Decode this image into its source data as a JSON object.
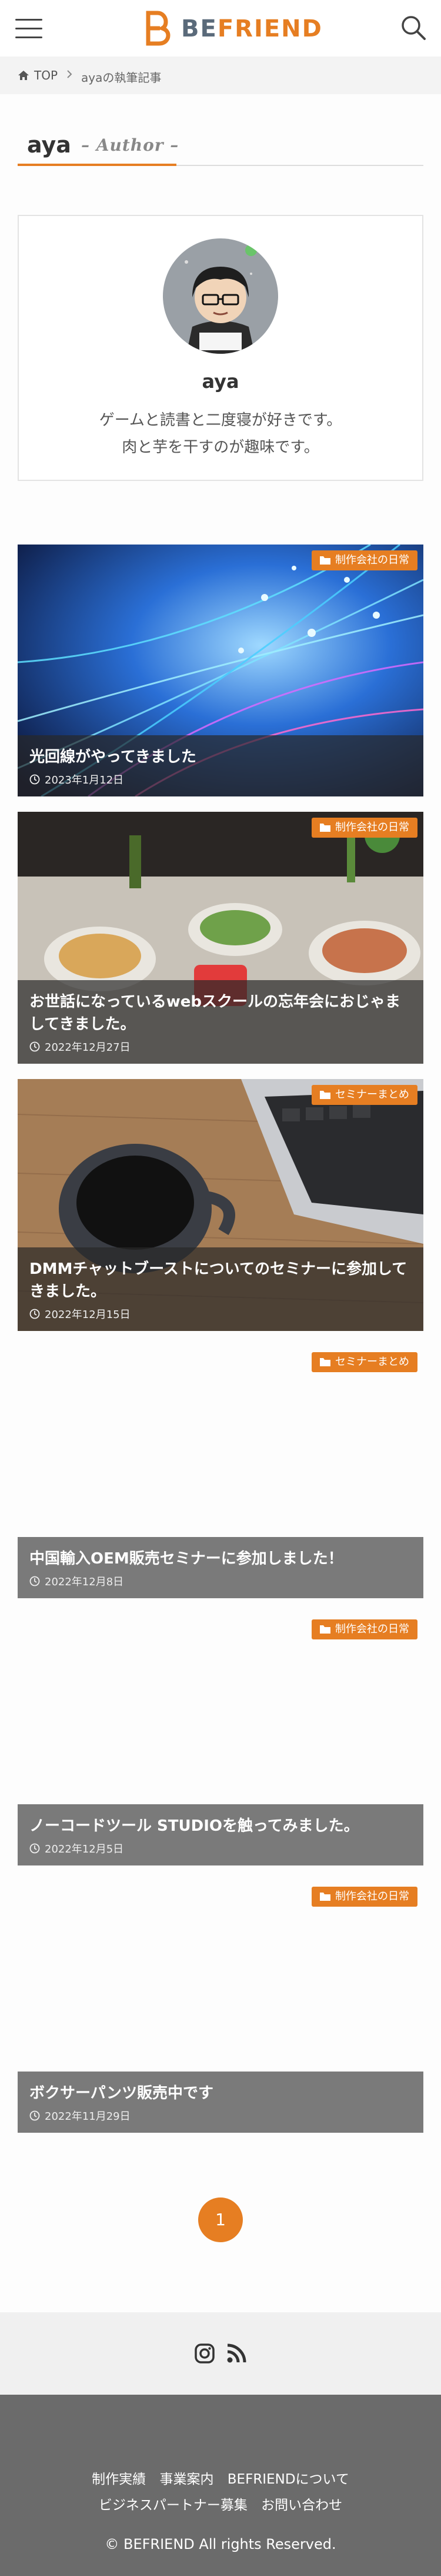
{
  "header": {
    "logo_text_be": "BE",
    "logo_text_friend": "FRIEND",
    "accent_color": "#e67e22"
  },
  "breadcrumb": {
    "home": "TOP",
    "current": "ayaの執筆記事"
  },
  "author_heading": {
    "name": "aya",
    "subtitle": "– Author –"
  },
  "profile": {
    "name": "aya",
    "bio_line1": "ゲームと読書と二度寝が好きです。",
    "bio_line2": "肉と芋を干すのが趣味です。"
  },
  "posts": [
    {
      "category": "制作会社の日常",
      "title": "光回線がやってきました",
      "date": "2023年1月12日"
    },
    {
      "category": "制作会社の日常",
      "title": "お世話になっているwebスクールの忘年会におじゃましてきました。",
      "date": "2022年12月27日"
    },
    {
      "category": "セミナーまとめ",
      "title": "DMMチャットブーストについてのセミナーに参加してきました。",
      "date": "2022年12月15日"
    },
    {
      "category": "セミナーまとめ",
      "title": "中国輸入OEM販売セミナーに参加しました！",
      "date": "2022年12月8日"
    },
    {
      "category": "制作会社の日常",
      "title": "ノーコードツール STUDIOを触ってみました。",
      "date": "2022年12月5日"
    },
    {
      "category": "制作会社の日常",
      "title": "ボクサーパンツ販売中です",
      "date": "2022年11月29日"
    }
  ],
  "pagination": {
    "current": "1"
  },
  "footer": {
    "links_row1": [
      "制作実績",
      "事業案内",
      "BEFRIENDについて"
    ],
    "links_row2": [
      "ビジネスパートナー募集",
      "お問い合わせ"
    ],
    "copyright": "© BEFRIEND All rights Reserved."
  }
}
